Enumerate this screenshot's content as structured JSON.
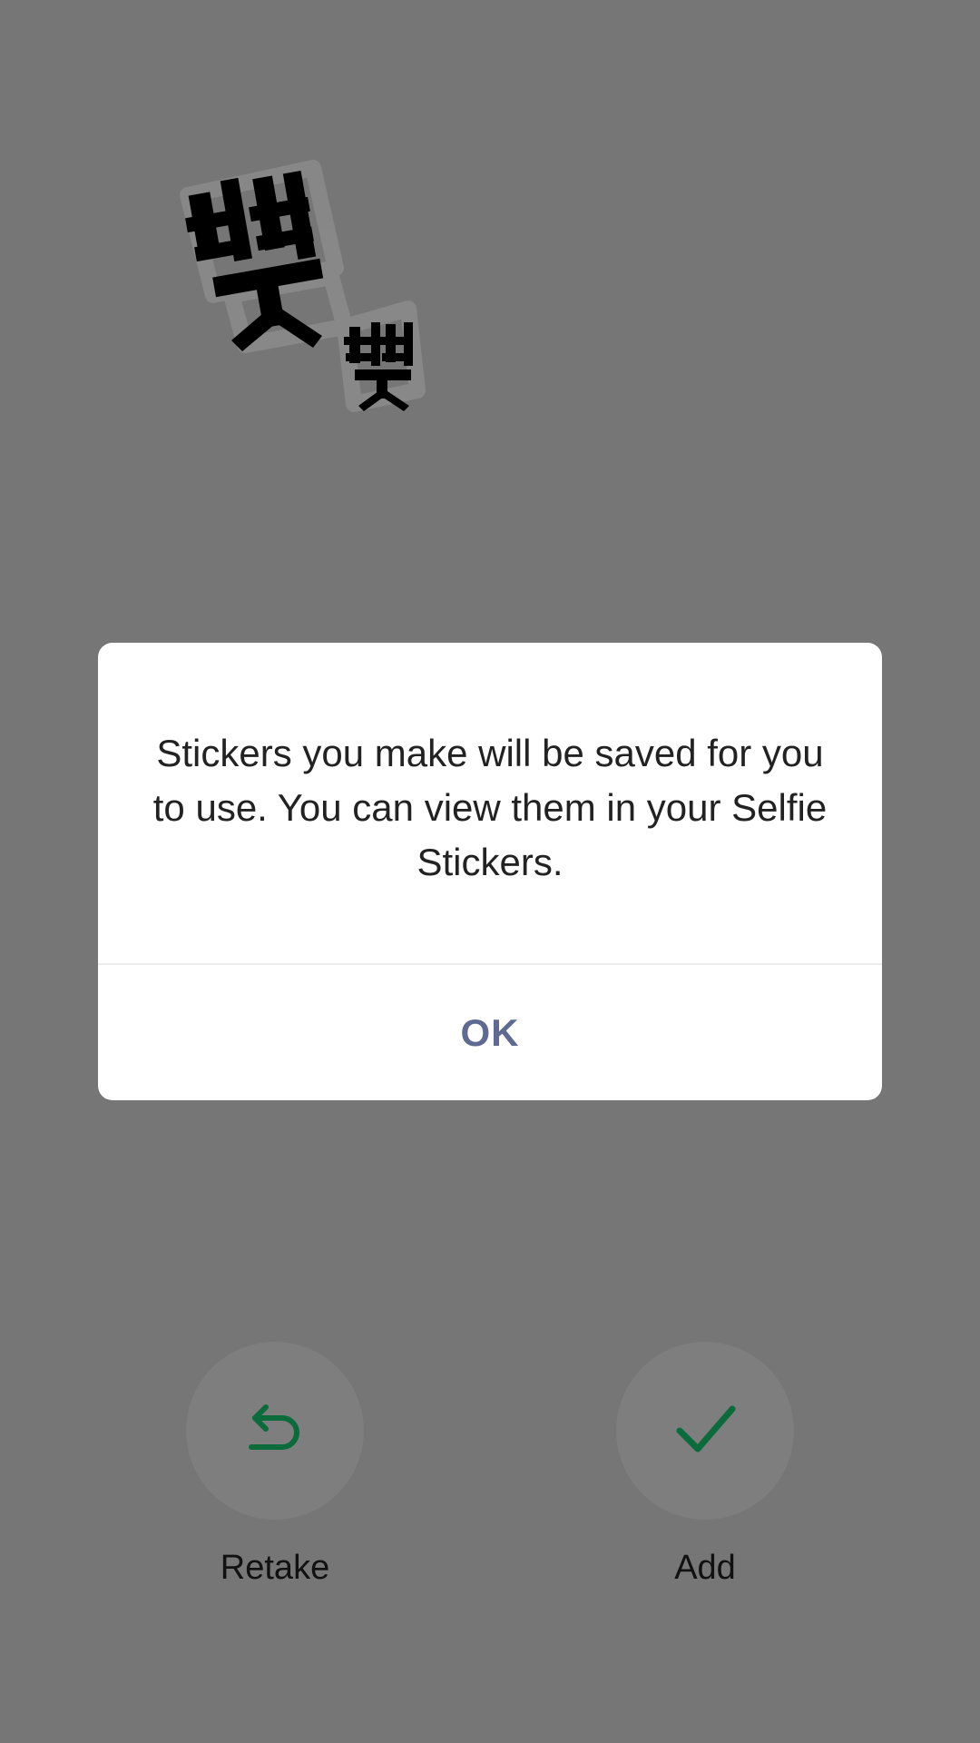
{
  "dialog": {
    "message": "Stickers you make will be saved for you to use. You can view them in your Selfie Stickers.",
    "ok_label": "OK"
  },
  "actions": {
    "retake_label": "Retake",
    "add_label": "Add"
  },
  "icons": {
    "retake": "undo-arrow-icon",
    "add": "checkmark-icon"
  },
  "colors": {
    "accent_green": "#0b6b3a",
    "ok_text": "#5e6a91",
    "overlay": "#767676"
  }
}
